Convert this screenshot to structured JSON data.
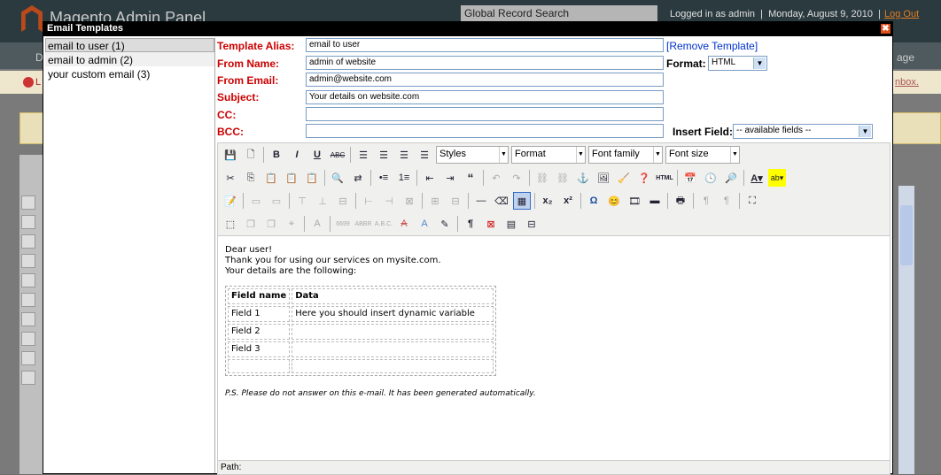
{
  "background": {
    "title": "Magento Admin Panel",
    "global_search": "Global Record Search",
    "logged_in": "Logged in as admin",
    "date": "Monday, August 9, 2010",
    "logout": "Log Out",
    "nav_left": "D",
    "nav_right": "age",
    "msg_left": "L",
    "msg_right": "nbox."
  },
  "dialog": {
    "title": "Email Templates",
    "close": "✖"
  },
  "templates": [
    {
      "label": "email to user (1)"
    },
    {
      "label": "email to admin (2)"
    },
    {
      "label": "your custom email (3)"
    }
  ],
  "form": {
    "alias_label": "Template Alias:",
    "alias_value": "email to user",
    "remove_link": "Remove Template",
    "from_name_label": "From Name:",
    "from_name_value": "admin of website",
    "format_label": "Format:",
    "format_value": "HTML",
    "from_email_label": "From Email:",
    "from_email_value": "admin@website.com",
    "subject_label": "Subject:",
    "subject_value": "Your details on website.com",
    "cc_label": "CC:",
    "cc_value": "",
    "bcc_label": "BCC:",
    "bcc_value": "",
    "insert_field_label": "Insert Field:",
    "insert_field_value": "-- available fields --"
  },
  "toolbar": {
    "styles": "Styles",
    "format": "Format",
    "font_family": "Font family",
    "font_size": "Font size"
  },
  "editor": {
    "line1": "Dear user!",
    "line2": "Thank you for using our services on mysite.com.",
    "line3": "Your details are the following:",
    "table": {
      "headers": [
        "Field name",
        "Data"
      ],
      "rows": [
        [
          "Field 1",
          "Here you should insert dynamic variable"
        ],
        [
          "Field 2",
          ""
        ],
        [
          "Field 3",
          ""
        ],
        [
          "",
          ""
        ]
      ]
    },
    "ps": "P.S. Please do not answer on this e-mail. It has been generated automatically.",
    "path_label": "Path:"
  }
}
